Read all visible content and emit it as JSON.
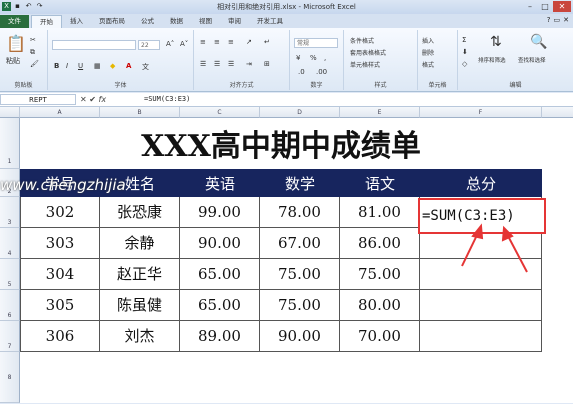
{
  "window": {
    "title": "相对引用和绝对引用.xlsx - Microsoft Excel",
    "minimize": "–",
    "maximize": "□",
    "close": "✕"
  },
  "tabs": [
    "文件",
    "开始",
    "插入",
    "页面布局",
    "公式",
    "数据",
    "视图",
    "审阅",
    "开发工具"
  ],
  "ribbon": {
    "paste": "粘贴",
    "clipboard": "剪贴板",
    "font_group": "字体",
    "align_group": "对齐方式",
    "number_group": "数字",
    "number_format": "常规",
    "styles_group": "样式",
    "cond_format": "条件格式",
    "table_format": "套用表格格式",
    "cell_style": "单元格样式",
    "cells_group": "单元格",
    "insert": "插入",
    "delete": "删除",
    "format": "格式",
    "sort": "排序和筛选",
    "find": "查找和选择",
    "editing": "编辑",
    "font_size": "22"
  },
  "formula_bar": {
    "name_box": "REPT",
    "cancel": "✕",
    "enter": "✔",
    "fx": "fx",
    "content": "=SUM(C3:E3)"
  },
  "columns": [
    "A",
    "B",
    "C",
    "D",
    "E",
    "F"
  ],
  "rows": [
    "1",
    "2",
    "3",
    "4",
    "5",
    "6",
    "7",
    "8"
  ],
  "sheet": {
    "title": "XXX高中期中成绩单",
    "headers": [
      "学号",
      "姓名",
      "英语",
      "数学",
      "语文",
      "总分"
    ],
    "data": [
      [
        "302",
        "张恐康",
        "99.00",
        "78.00",
        "81.00"
      ],
      [
        "303",
        "余静",
        "90.00",
        "67.00",
        "86.00"
      ],
      [
        "304",
        "赵正华",
        "65.00",
        "75.00",
        "75.00"
      ],
      [
        "305",
        "陈虽健",
        "65.00",
        "75.00",
        "80.00"
      ],
      [
        "306",
        "刘杰",
        "89.00",
        "90.00",
        "70.00"
      ]
    ],
    "formula_cell": "=SUM(C3:E3)"
  },
  "watermark": "www.chengzhijia",
  "accent_colors": {
    "header_band": "#17255e",
    "highlight": "#e53535",
    "file_tab": "#2a6e3d"
  }
}
